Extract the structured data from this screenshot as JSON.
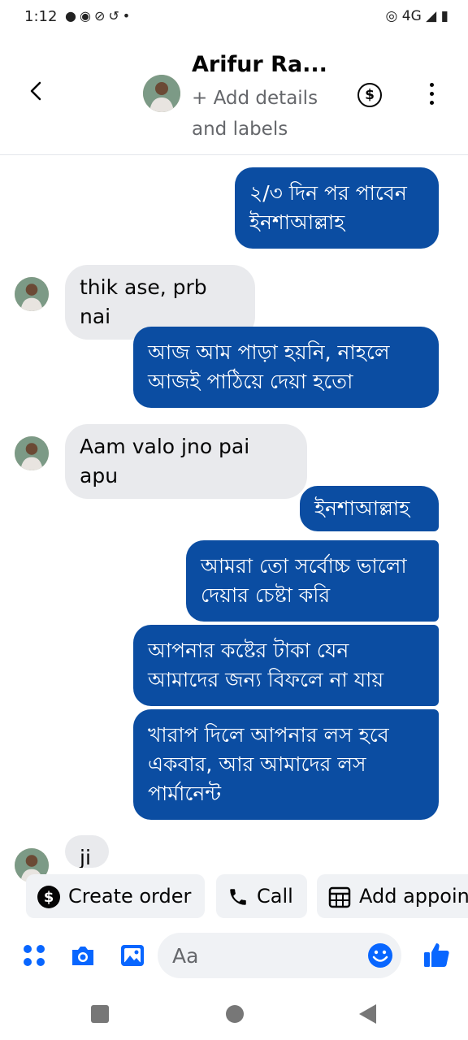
{
  "status_bar": {
    "time": "1:12",
    "left_icons": [
      "chat-bubble-icon",
      "messenger-icon",
      "no-disturb-icon",
      "sync-icon",
      "dot-icon"
    ],
    "network": "4G",
    "right_icons": [
      "hotspot-icon",
      "signal-icon",
      "battery-icon"
    ]
  },
  "header": {
    "contact_name": "Arifur Ra...",
    "sub_line1": "+ Add details",
    "sub_line2": "and labels",
    "currency_symbol": "$",
    "accent": "#0b4da2"
  },
  "messages": [
    {
      "dir": "out",
      "text": "২/৩ দিন পর পাবেন ইনশাআল্লাহ"
    },
    {
      "dir": "in",
      "text": "thik ase, prb nai"
    },
    {
      "dir": "out",
      "text": "আজ আম পাড়া হয়নি, নাহলে আজই পাঠিয়ে দেয়া হতো"
    },
    {
      "dir": "in",
      "text": "Aam valo jno pai apu"
    },
    {
      "dir": "out",
      "text": "ইনশাআল্লাহ"
    },
    {
      "dir": "out",
      "text": "আমরা তো সর্বোচ্চ ভালো দেয়ার চেষ্টা করি"
    },
    {
      "dir": "out",
      "text": "আপনার কষ্টের টাকা যেন আমাদের জন্য বিফলে না যায়"
    },
    {
      "dir": "out",
      "text": "খারাপ দিলে আপনার লস হবে একবার, আর আমাদের লস পার্মানেন্ট"
    },
    {
      "dir": "in",
      "text": "ji"
    }
  ],
  "actions": [
    {
      "label": "Create order",
      "icon": "dollar-circle-icon"
    },
    {
      "label": "Call",
      "icon": "phone-icon"
    },
    {
      "label": "Add appoin",
      "icon": "calendar-icon"
    }
  ],
  "composer": {
    "placeholder": "Aa",
    "icons": [
      "apps-icon",
      "camera-icon",
      "gallery-icon",
      "emoji-icon",
      "thumbs-up-icon"
    ]
  },
  "nav": [
    "recents-button",
    "home-button",
    "back-button"
  ]
}
